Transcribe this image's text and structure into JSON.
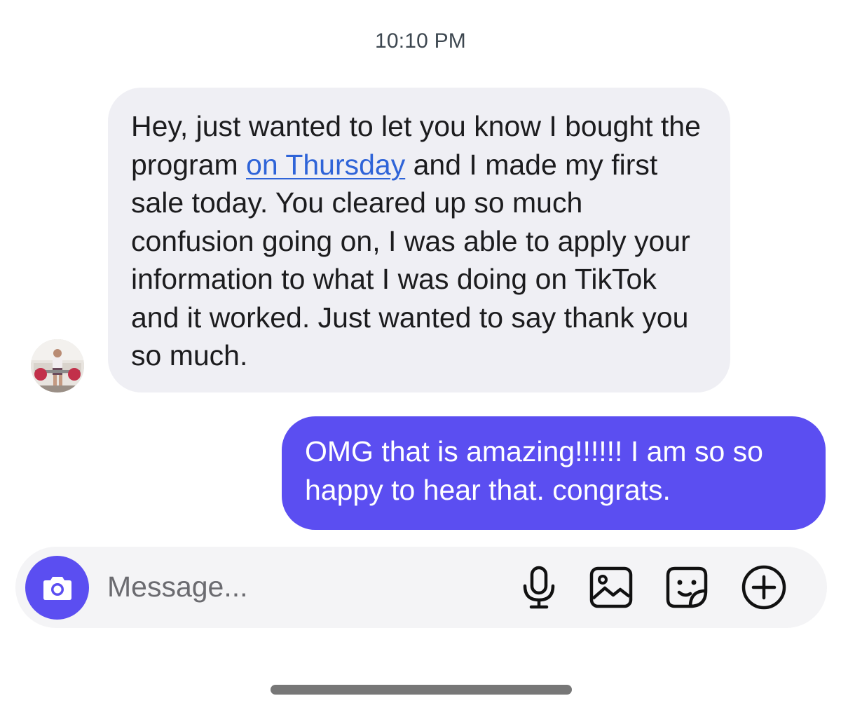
{
  "thread": {
    "timestamp": "10:10 PM"
  },
  "messages": [
    {
      "direction": "incoming",
      "sender_avatar": "avatar",
      "text_before_link": "Hey, just wanted to let you know I bought the program ",
      "link_text": "on Thursday",
      "text_after_link": " and I made my first sale today. You cleared up so much confusion going on, I was able to apply your information to what I was doing on TikTok and it worked. Just wanted to say thank you so much."
    },
    {
      "direction": "outgoing",
      "text": "OMG that is amazing!!!!!! I am so so happy to hear that. congrats."
    }
  ],
  "composer": {
    "placeholder": "Message...",
    "value": "",
    "camera_icon": "camera-icon",
    "tools": [
      "microphone-icon",
      "gallery-icon",
      "sticker-icon",
      "plus-circle-icon"
    ]
  },
  "colors": {
    "accent": "#5b4ef1",
    "incoming_bubble": "#efeff4",
    "link": "#2f64d8",
    "composer_bg": "#f4f4f6"
  }
}
